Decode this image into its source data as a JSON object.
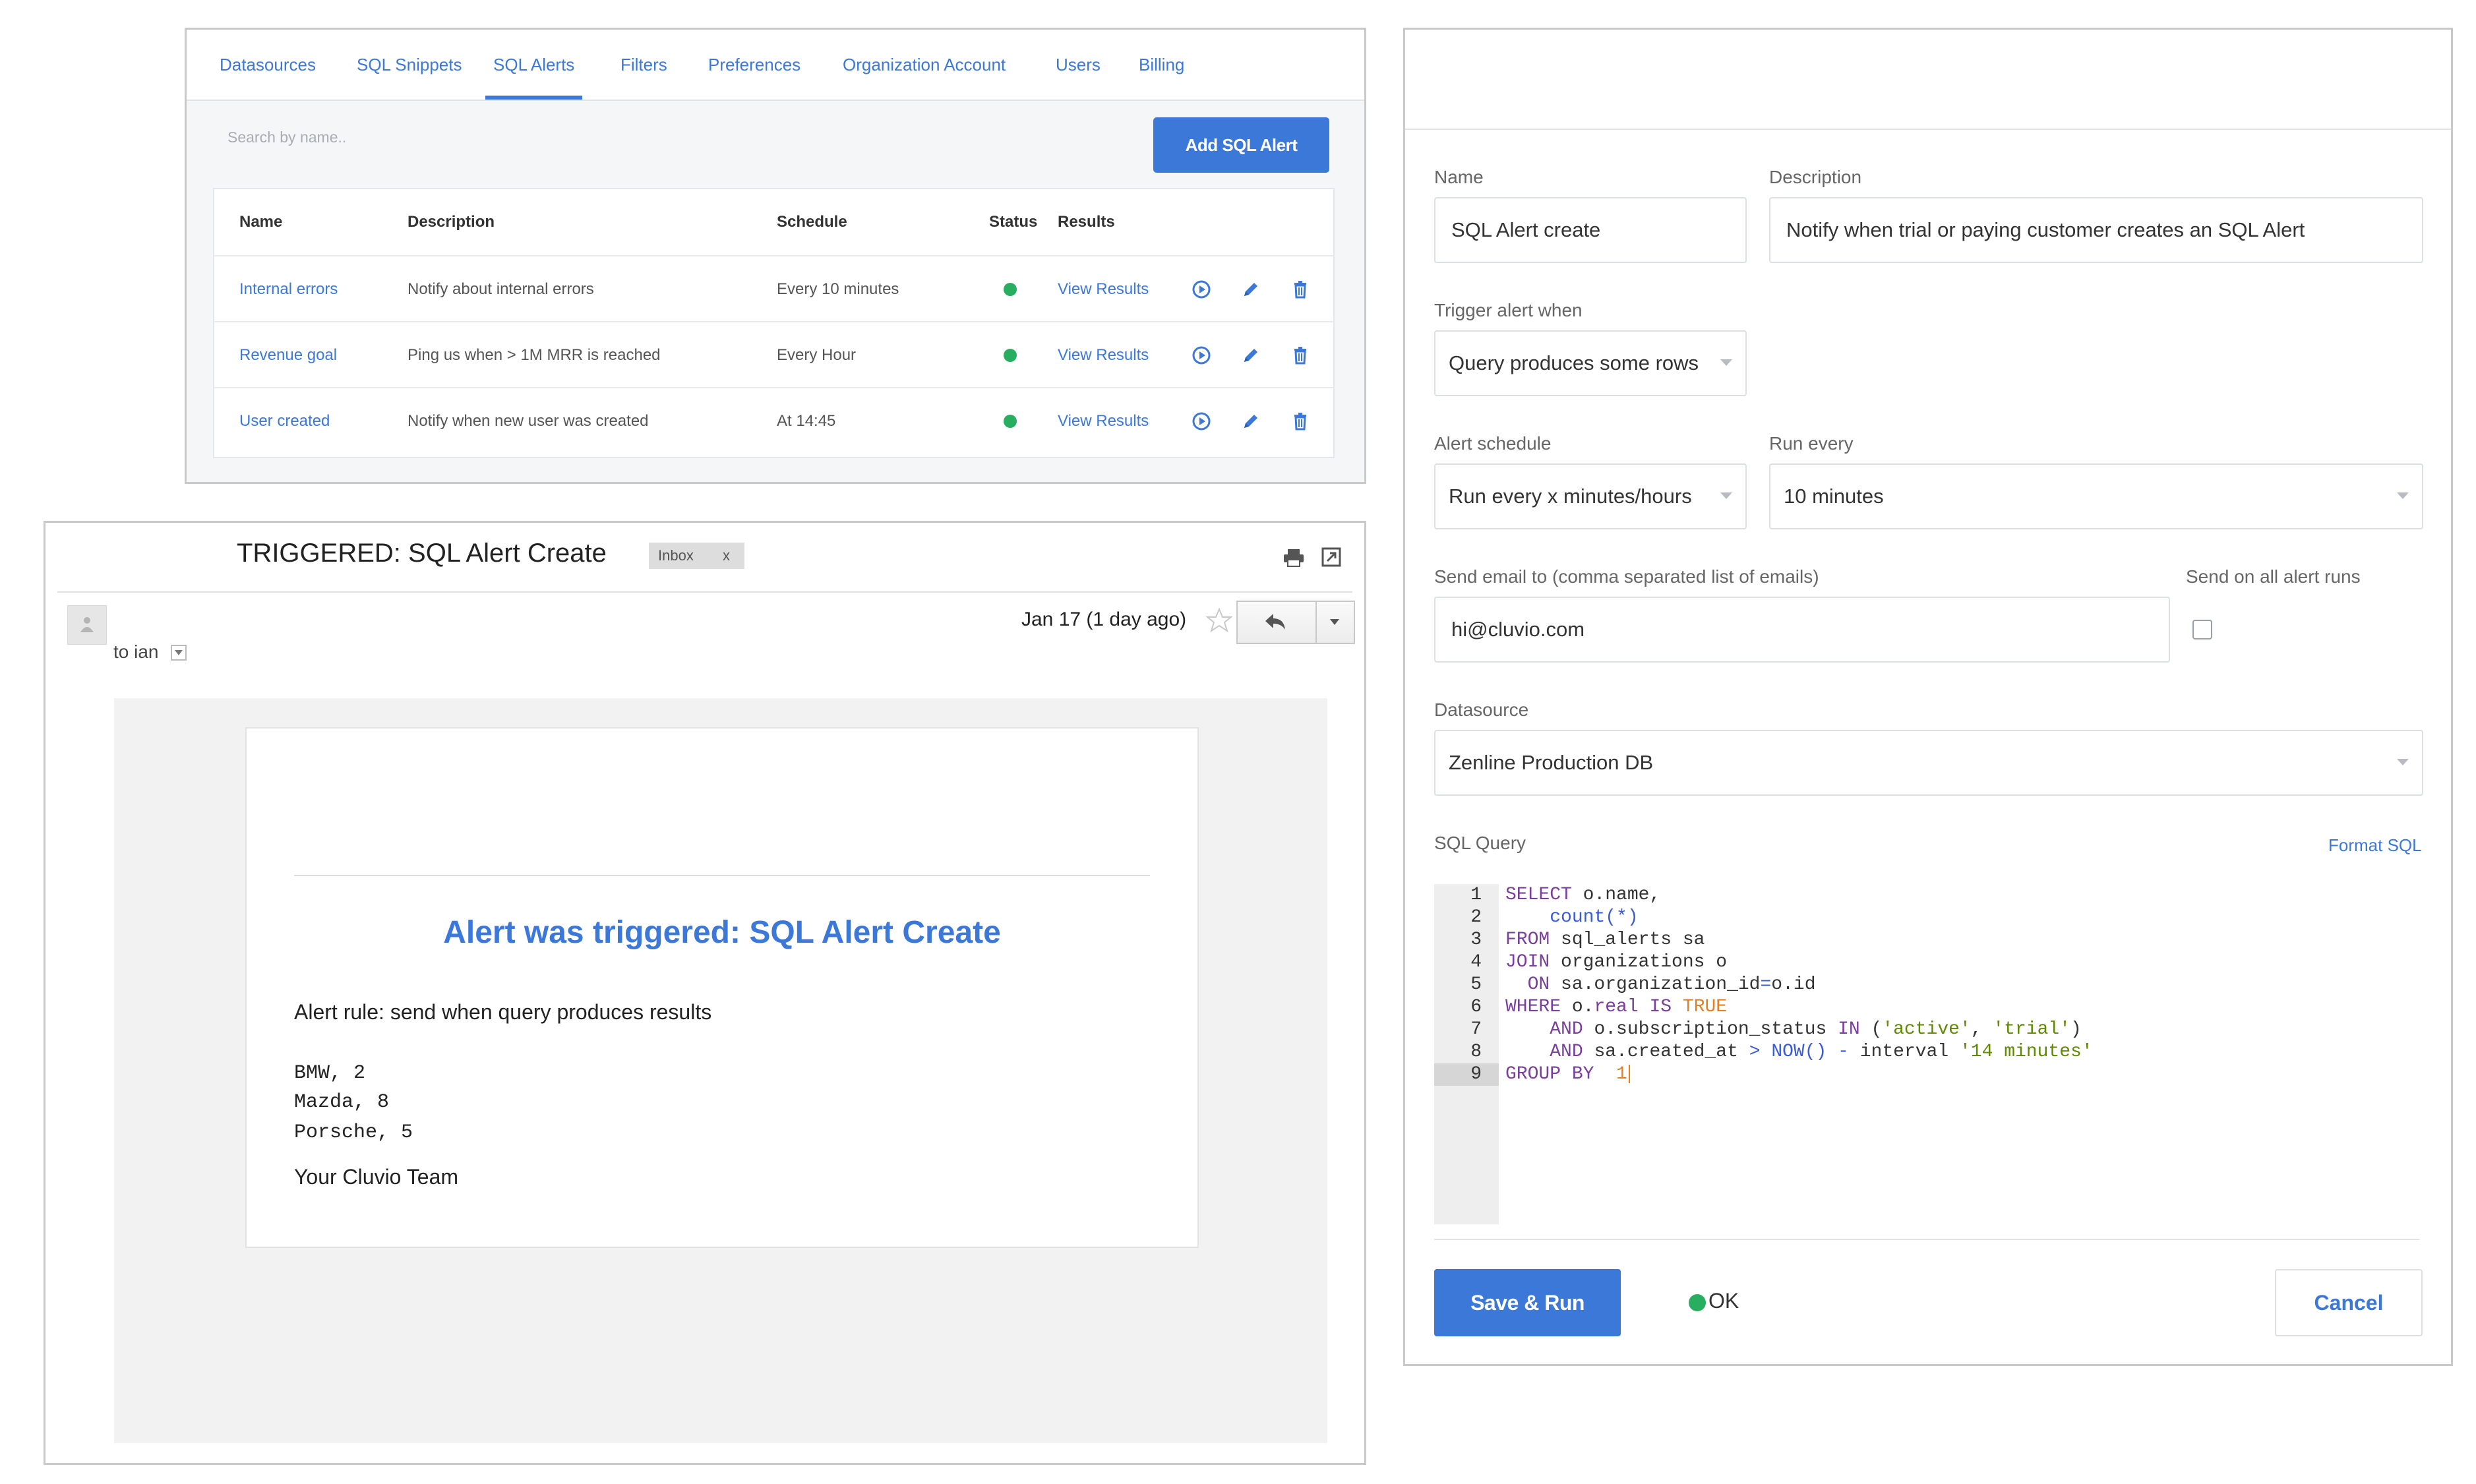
{
  "alerts_panel": {
    "tabs": [
      "Datasources",
      "SQL Snippets",
      "SQL Alerts",
      "Filters",
      "Preferences",
      "Organization Account",
      "Users",
      "Billing"
    ],
    "active_tab": "SQL Alerts",
    "search_placeholder": "Search by name..",
    "add_button": "Add SQL Alert",
    "columns": [
      "Name",
      "Description",
      "Schedule",
      "Status",
      "Results"
    ],
    "rows": [
      {
        "name": "Internal errors",
        "description": "Notify about internal errors",
        "schedule": "Every 10 minutes",
        "results": "View Results"
      },
      {
        "name": "Revenue goal",
        "description": "Ping us when > 1M MRR is reached",
        "schedule": "Every Hour",
        "results": "View Results"
      },
      {
        "name": "User created",
        "description": "Notify when new user was created",
        "schedule": "At 14:45",
        "results": "View Results"
      }
    ],
    "status_color": "#27ae60",
    "accent": "#3b78d8"
  },
  "email": {
    "subject": "TRIGGERED: SQL Alert Create",
    "label": "Inbox",
    "label_close": "x",
    "to": "to ian",
    "date": "Jan 17 (1 day ago)",
    "title": "Alert was triggered: SQL Alert Create",
    "rule": "Alert rule: send when query produces results",
    "results": [
      "BMW, 2",
      "Mazda, 8",
      "Porsche, 5"
    ],
    "signature": "Your Cluvio Team"
  },
  "form": {
    "name_label": "Name",
    "name_value": "SQL Alert create",
    "description_label": "Description",
    "description_value": "Notify when trial or paying customer creates an SQL Alert",
    "trigger_label": "Trigger alert when",
    "trigger_value": "Query produces some rows",
    "schedule_label": "Alert schedule",
    "schedule_value": "Run every x minutes/hours",
    "run_every_label": "Run every",
    "run_every_value": "10 minutes",
    "email_label": "Send email to (comma separated list of emails)",
    "email_value": "hi@cluvio.com",
    "send_all_label": "Send on all alert runs",
    "datasource_label": "Datasource",
    "datasource_value": "Zenline Production DB",
    "sql_label": "SQL Query",
    "format_sql": "Format SQL",
    "line_numbers": [
      "1",
      "2",
      "3",
      "4",
      "5",
      "6",
      "7",
      "8",
      "9"
    ],
    "save_button": "Save & Run",
    "status_text": "OK",
    "cancel_button": "Cancel"
  }
}
